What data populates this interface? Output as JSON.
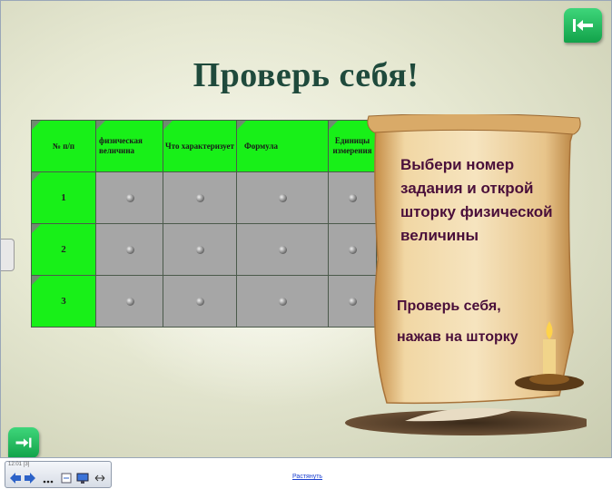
{
  "slide": {
    "title": "Проверь себя!",
    "table": {
      "headers": [
        "№ п/п",
        "физическая величина",
        "Что характеризует",
        "Формула",
        "Единицы измерения"
      ],
      "rows": [
        "1",
        "2",
        "3"
      ]
    },
    "scroll": {
      "instruction": "Выбери номер задания и открой шторку физической величины",
      "hint_line1": "Проверь себя,",
      "hint_line2": "нажав на шторку"
    },
    "nav": {
      "back_icon": "arrow-left-icon",
      "next_icon": "arrow-right-icon"
    }
  },
  "toolbar": {
    "title": "12:01 [3]"
  },
  "footer": {
    "link": "Растянуть"
  },
  "colors": {
    "green_cell": "#18f018",
    "grey_cell": "#a6a6a6",
    "title": "#1f4a3c",
    "scroll_text": "#4a0f3a"
  }
}
